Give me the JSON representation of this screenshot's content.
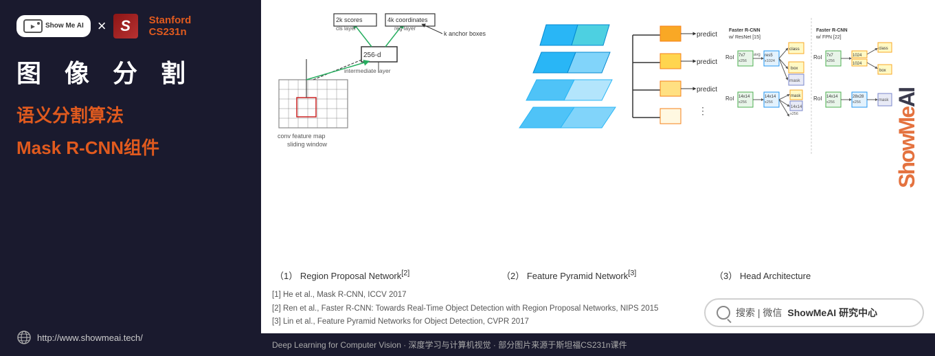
{
  "left": {
    "logo_showmeai": "Show Me AI",
    "x_separator": "×",
    "stanford_name": "Stanford",
    "stanford_course": "CS231n",
    "main_title": "图 像 分 割",
    "sub_title": "语义分割算法",
    "component_title": "Mask R-CNN组件",
    "website_url": "http://www.showmeai.tech/"
  },
  "right": {
    "labels": [
      {
        "num": "(1)",
        "title": "Region Proposal Network",
        "ref": "[2]"
      },
      {
        "num": "(2)",
        "title": "Feature Pyramid Network",
        "ref": "[3]"
      },
      {
        "num": "(3)",
        "title": "Head Architecture",
        "ref": ""
      }
    ],
    "references": [
      "[1] He et al., Mask R-CNN, ICCV 2017",
      "[2] Ren et al., Faster R-CNN: Towards Real-Time Object Detection with Region Proposal Networks, NIPS 2015",
      "[3] Lin et al., Feature Pyramid Networks for Object Detection, CVPR 2017"
    ],
    "search_text": "搜索 | 微信",
    "search_brand": "ShowMeAI 研究中心",
    "footer_text": "Deep Learning for Computer Vision · 深度学习与计算机视觉 · 部分图片来源于斯坦福CS231n课件",
    "watermark": "ShowMeAI"
  }
}
